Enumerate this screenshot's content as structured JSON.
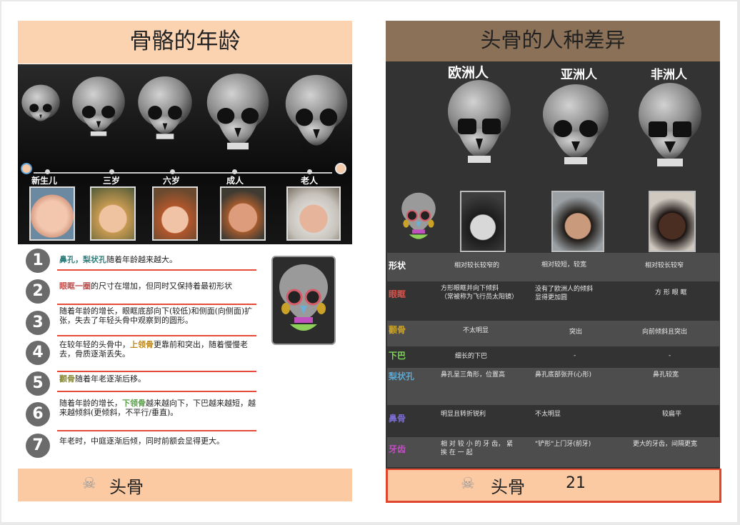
{
  "left": {
    "title": "骨骼的年龄",
    "ages": [
      "新生儿",
      "三岁",
      "六岁",
      "成人",
      "老人"
    ],
    "items": [
      {
        "n": "1",
        "parts": [
          "鼻孔，梨状孔",
          "随着年龄越来越大。"
        ]
      },
      {
        "n": "2",
        "parts": [
          "眼眶一圈",
          "的尺寸在增加，但同时又保持着最初形状"
        ]
      },
      {
        "n": "3",
        "text": "随着年龄的增长，眼眶底部向下(较低)和侧面(向侧面)扩张，失去了年轻头骨中观察到的圆形。"
      },
      {
        "n": "4",
        "parts": [
          "在较年轻的头骨中，",
          "上领骨",
          "更靠前和突出，随着慢慢老去，骨质逐渐丢失。"
        ]
      },
      {
        "n": "5",
        "parts": [
          "颧骨",
          "随着年老逐渐后移。"
        ]
      },
      {
        "n": "6",
        "parts": [
          "随着年龄的增长，",
          "下领骨",
          "越来越向下，下巴越来越短，越来越倾斜(更倾斜，不平行/垂直)。"
        ]
      },
      {
        "n": "7",
        "text": "年老时，中庭逐渐后倾，同时前额会显得更大。"
      }
    ],
    "footer": "头骨"
  },
  "right": {
    "title": "头骨的人种差异",
    "races": [
      "欧洲人",
      "亚洲人",
      "非洲人"
    ],
    "rows": [
      {
        "label": "形状",
        "color": "#ffffff",
        "cells": [
          "相对较长较窄的",
          "相对较短，较宽",
          "相对较长较窄"
        ]
      },
      {
        "label": "眼眶",
        "color": "#e0504a",
        "cells": [
          "方形眼眶并向下倾斜\n（常被称为飞行员太阳镜）",
          "没有了欧洲人的倾斜\n显得更加圆",
          "方 形 眼 眶"
        ]
      },
      {
        "label": "颧骨",
        "color": "#c9a227",
        "cells": [
          "不太明显",
          "突出",
          "向前倾斜且突出"
        ]
      },
      {
        "label": "下巴",
        "color": "#7ed957",
        "cells": [
          "细长的下巴",
          "-",
          "-"
        ]
      },
      {
        "label": "梨状孔",
        "color": "#5aa9d6",
        "cells": [
          "鼻孔呈三角形，位置高",
          "鼻孔底部张开(心形)",
          "鼻孔较宽"
        ]
      },
      {
        "label": "鼻骨",
        "color": "#7a6ccf",
        "cells": [
          "明显且转折锐利",
          "不太明显",
          "较扁平"
        ]
      },
      {
        "label": "牙齿",
        "color": "#c04fc0",
        "cells": [
          "相 对 较 小 的 牙 齿， 紧\n挨 在 一 起",
          "\"铲形\"上门牙(前牙)",
          "更大的牙齿，间隔更宽"
        ]
      }
    ],
    "footer": "头骨",
    "page_number": "21"
  },
  "icons": [
    "skull-icon",
    "baby-icon",
    "elder-icon"
  ]
}
